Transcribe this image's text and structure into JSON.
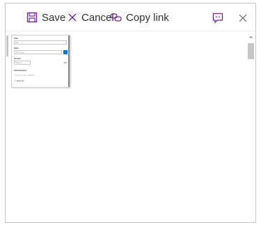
{
  "toolbar": {
    "save_label": "Save",
    "cancel_label": "Cancel",
    "copy_link_label": "Copy link",
    "accent_color": "#7719aa",
    "save_icon": "save-icon",
    "cancel_icon": "dismiss-icon",
    "copy_icon": "link-icon",
    "feedback_icon": "feedback-icon",
    "close_icon": "close-icon"
  },
  "form_preview": {
    "title_label": "Title",
    "title_value": "Title",
    "date_label": "Date",
    "date_value": "dd.mm.yyyy",
    "choice_label": "Choice",
    "choice_value": "Option 1",
    "attachments_label": "Attachments",
    "attachments_hint": "There is nothing attached.",
    "attach_link": "Attach file"
  }
}
